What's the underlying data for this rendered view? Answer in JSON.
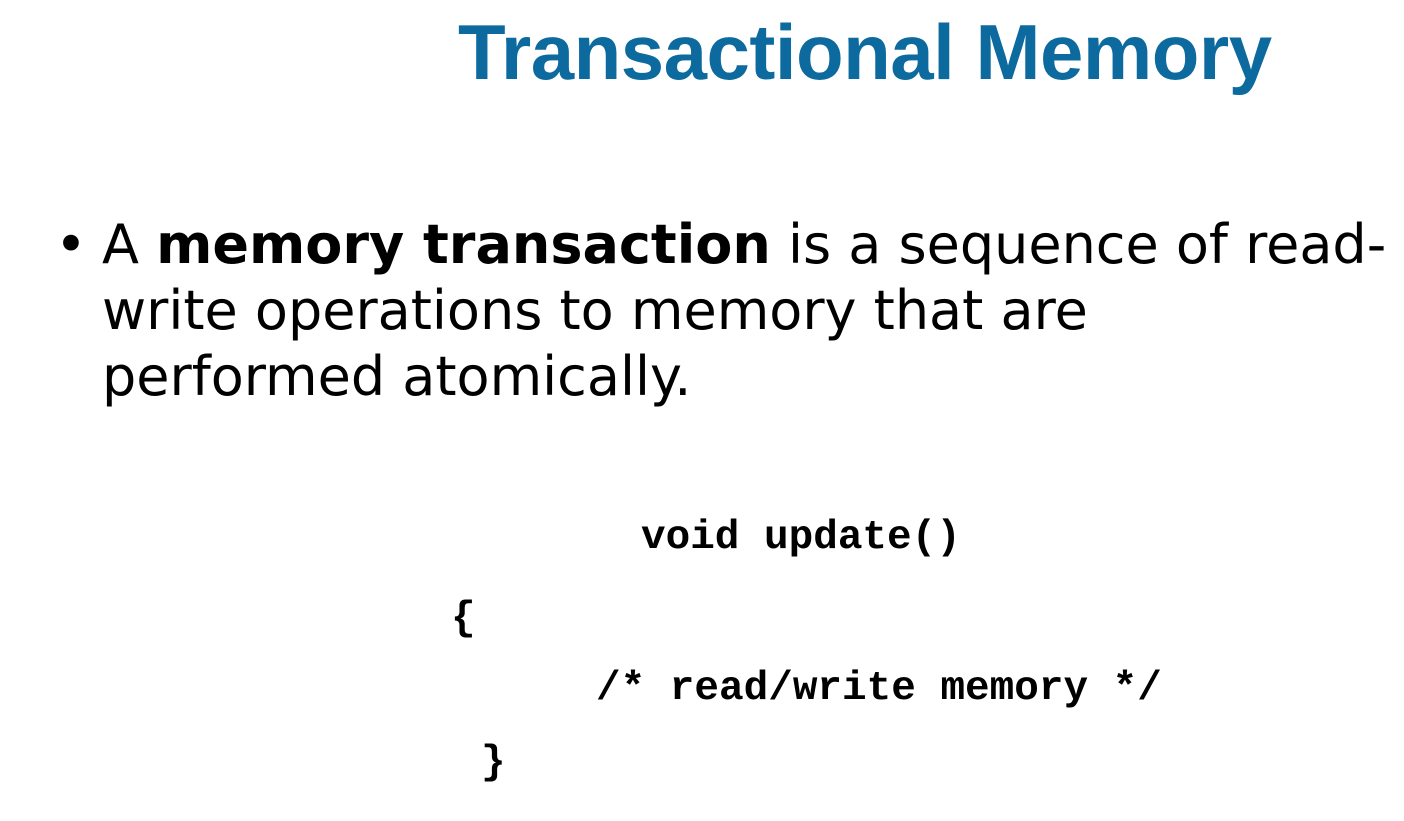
{
  "slide": {
    "title": "Transactional Memory",
    "bullet": {
      "marker": "•",
      "prefix": "A ",
      "bold_term": "memory transaction",
      "line1_rest": " is a sequence of read-",
      "line2": "write operations to memory that are",
      "line3": "performed atomically."
    },
    "code_lines": [
      "void update()",
      "{",
      "/* read/write memory */",
      "}"
    ],
    "colors": {
      "title": "#0d6a9e",
      "text": "#000000",
      "background": "#ffffff"
    }
  }
}
